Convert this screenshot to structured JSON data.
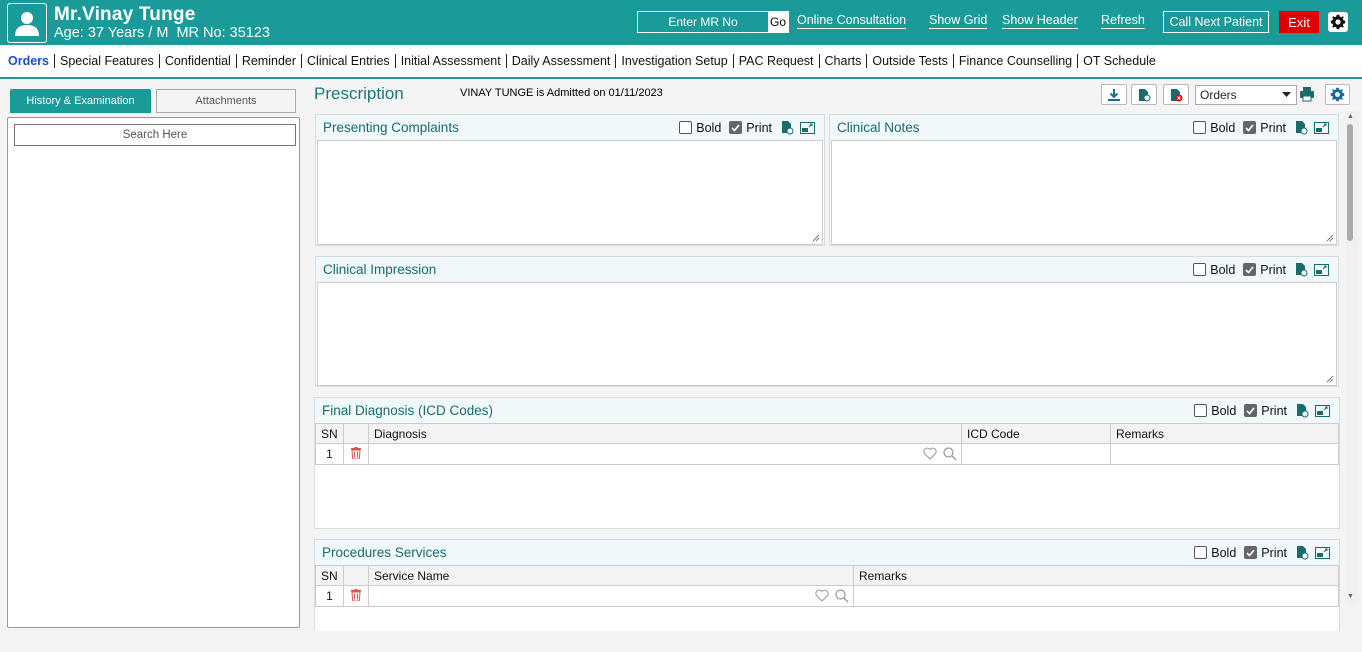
{
  "header": {
    "patient_name": "Mr.Vinay Tunge",
    "age_text": "Age: 37 Years / M",
    "mr_text": "MR No: 35123",
    "mr_placeholder": "Enter MR No",
    "go_label": "Go",
    "links": [
      "Online Consultation",
      "Show Grid",
      "Show Header",
      "Refresh"
    ],
    "call_next_label": "Call Next Patient",
    "exit_label": "Exit",
    "colors": {
      "primary": "#1b9a9a",
      "exit": "#e00000",
      "active_nav": "#1a4fc9"
    }
  },
  "nav": {
    "items": [
      "Orders",
      "Special Features",
      "Confidential",
      "Reminder",
      "Clinical Entries",
      "Initial Assessment",
      "Daily Assessment",
      "Investigation Setup",
      "PAC Request",
      "Charts",
      "Outside Tests",
      "Finance Counselling",
      "OT Schedule"
    ],
    "active": "Orders"
  },
  "left_panel": {
    "tabs": [
      "History & Examination",
      "Attachments"
    ],
    "active_tab": "History & Examination",
    "search_placeholder": "Search Here"
  },
  "main": {
    "title": "Prescription",
    "admitted_text": "VINAY TUNGE is Admitted on 01/11/2023",
    "orders_select": "Orders",
    "section_controls": {
      "bold_label": "Bold",
      "print_label": "Print"
    },
    "sections": {
      "presenting_complaints": {
        "title": "Presenting Complaints",
        "bold": false,
        "print": true
      },
      "clinical_notes": {
        "title": "Clinical Notes",
        "bold": false,
        "print": true
      },
      "clinical_impression": {
        "title": "Clinical Impression",
        "bold": false,
        "print": true
      },
      "final_diagnosis": {
        "title": "Final Diagnosis (ICD Codes)",
        "bold": false,
        "print": true,
        "columns": [
          "SN",
          "",
          "Diagnosis",
          "ICD Code",
          "Remarks"
        ],
        "rows": [
          {
            "sn": "1"
          }
        ]
      },
      "procedures": {
        "title": "Procedures Services",
        "bold": false,
        "print": true,
        "columns": [
          "SN",
          "",
          "Service Name",
          "Remarks"
        ],
        "rows": [
          {
            "sn": "1"
          }
        ]
      }
    }
  }
}
